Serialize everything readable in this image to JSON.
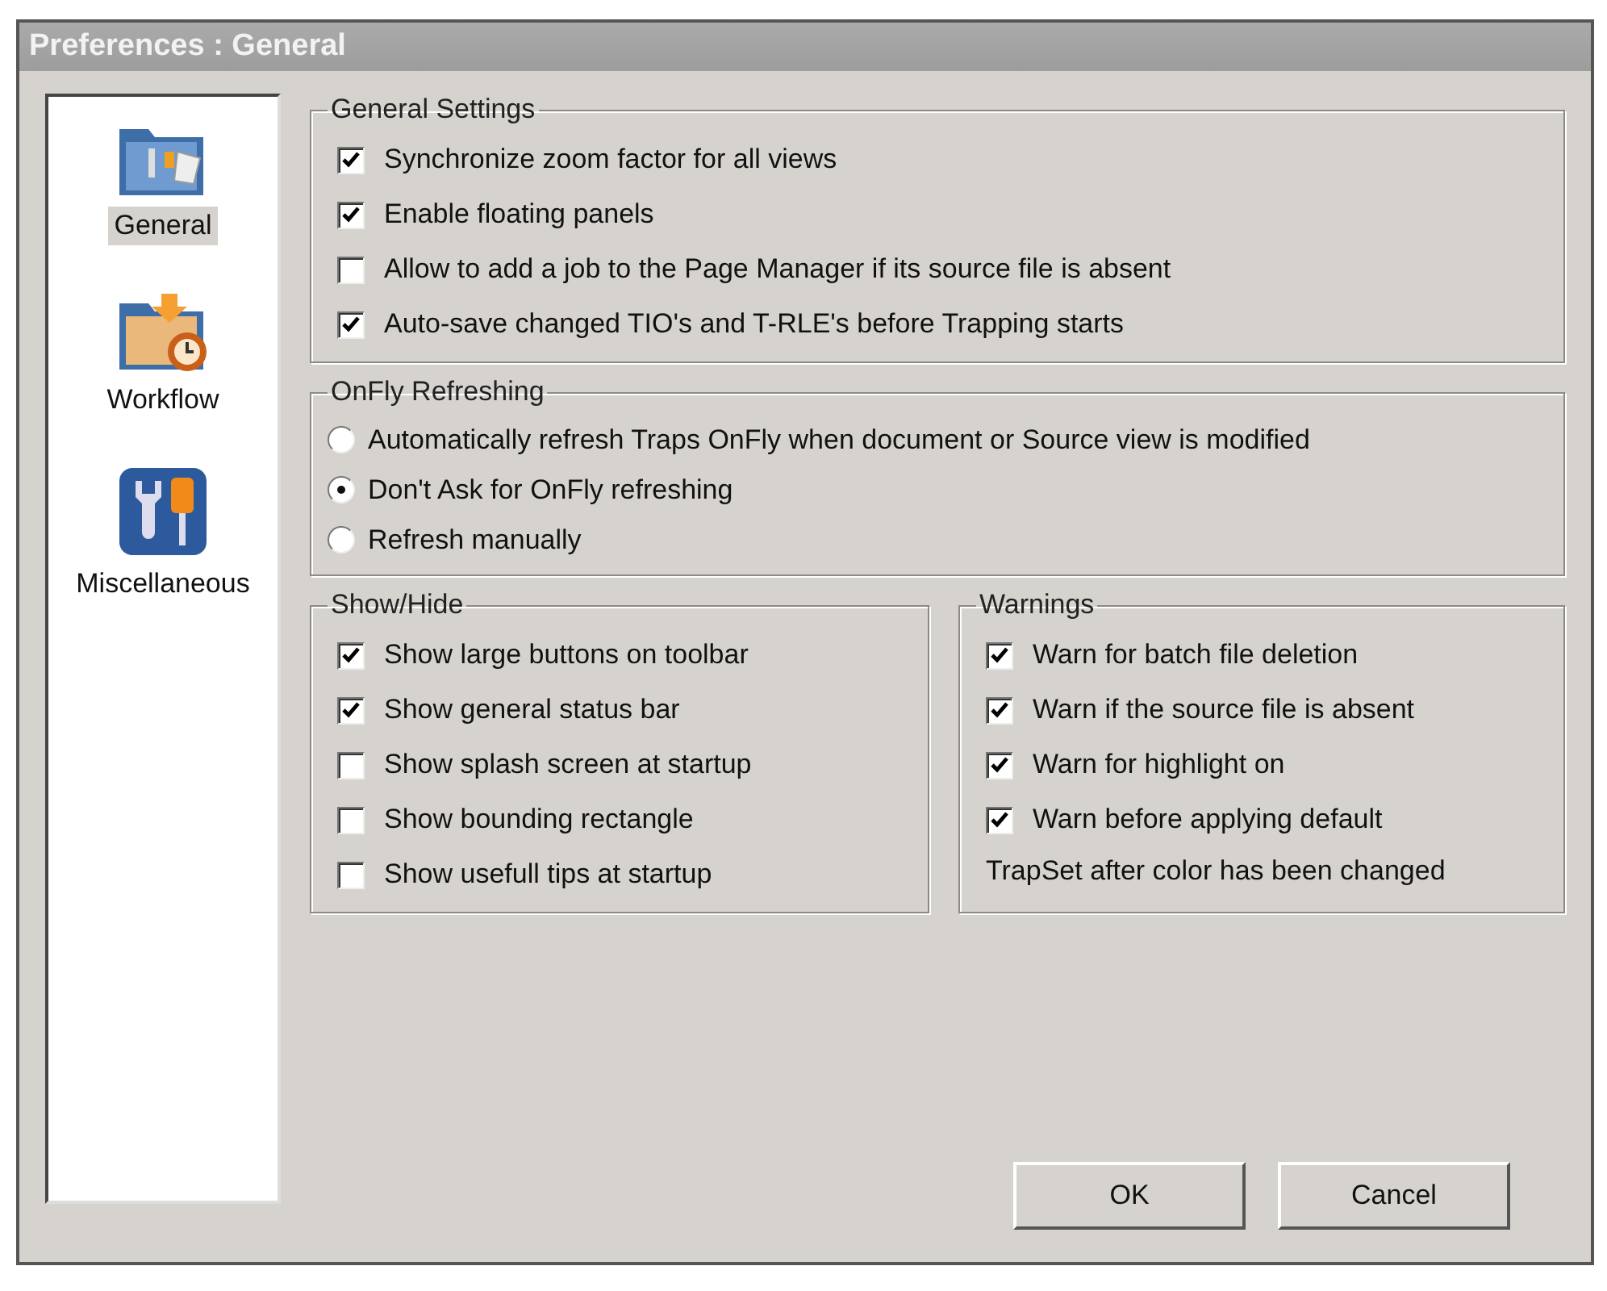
{
  "window": {
    "title": "Preferences : General"
  },
  "sidebar": {
    "items": [
      {
        "label": "General",
        "kind": "general",
        "selected": true
      },
      {
        "label": "Workflow",
        "kind": "workflow",
        "selected": false
      },
      {
        "label": "Miscellaneous",
        "kind": "misc",
        "selected": false
      }
    ]
  },
  "general_settings": {
    "title": "General Settings",
    "options": [
      {
        "label": "Synchronize zoom factor for all views",
        "checked": true
      },
      {
        "label": "Enable floating panels",
        "checked": true
      },
      {
        "label": "Allow to add a job to the Page Manager if its source file is absent",
        "checked": false
      },
      {
        "label": "Auto-save changed TIO's and T-RLE's before Trapping starts",
        "checked": true
      }
    ]
  },
  "onfly_refreshing": {
    "title": "OnFly Refreshing",
    "options": [
      {
        "label": "Automatically refresh Traps OnFly when document or Source view is modified",
        "selected": false
      },
      {
        "label": "Don't Ask for OnFly refreshing",
        "selected": true
      },
      {
        "label": "Refresh manually",
        "selected": false
      }
    ]
  },
  "show_hide": {
    "title": "Show/Hide",
    "options": [
      {
        "label": "Show large buttons on toolbar",
        "checked": true
      },
      {
        "label": "Show general status bar",
        "checked": true
      },
      {
        "label": "Show splash screen at startup",
        "checked": false
      },
      {
        "label": "Show bounding rectangle",
        "checked": false
      },
      {
        "label": "Show usefull tips at startup",
        "checked": false
      }
    ]
  },
  "warnings": {
    "title": "Warnings",
    "options": [
      {
        "label": "Warn for batch file deletion",
        "checked": true
      },
      {
        "label": "Warn if the source file is absent",
        "checked": true
      },
      {
        "label": "Warn for highlight on",
        "checked": true
      },
      {
        "label": "Warn before applying default",
        "checked": true
      }
    ],
    "note": "TrapSet after color has been changed"
  },
  "buttons": [
    "OK",
    "Cancel"
  ]
}
